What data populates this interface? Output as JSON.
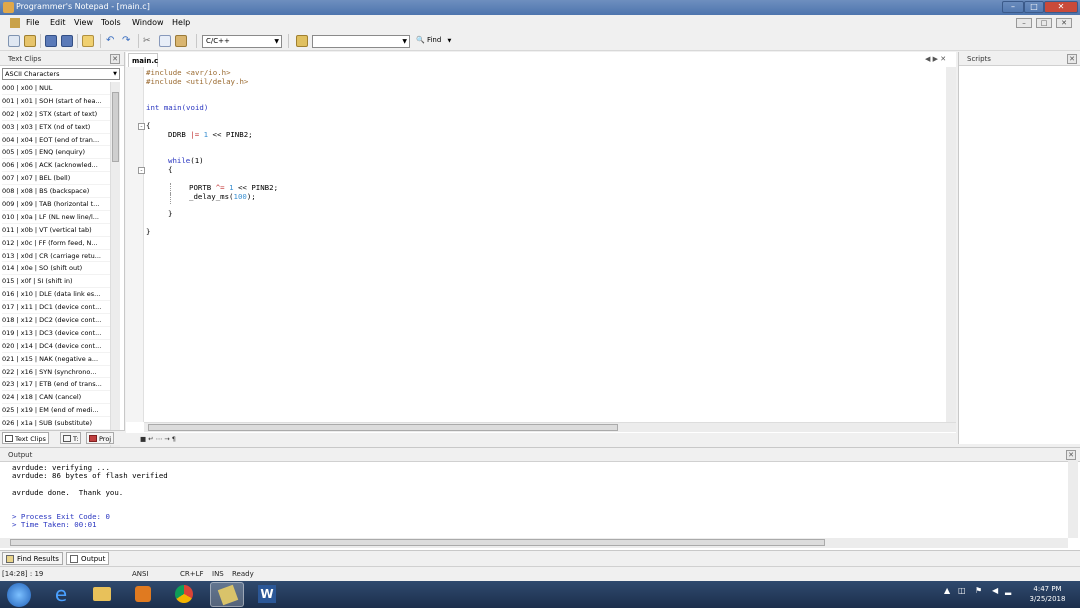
{
  "window": {
    "title": "Programmer's Notepad - [main.c]"
  },
  "menu": [
    "File",
    "Edit",
    "View",
    "Tools",
    "Window",
    "Help"
  ],
  "toolbar": {
    "scheme_value": "C/C++",
    "search_value": "",
    "find_label": "Find"
  },
  "left_panel": {
    "title": "Text Clips",
    "category": "ASCII Characters",
    "items": [
      "000 | x00 | NUL",
      "001 | x01 | SOH (start of hea...",
      "002 | x02 | STX (start of text)",
      "003 | x03 | ETX (nd of text)",
      "004 | x04 | EOT (end of tran...",
      "005 | x05 | ENQ (enquiry)",
      "006 | x06 | ACK (acknowled...",
      "007 | x07 | BEL (bell)",
      "008 | x08 | BS (backspace)",
      "009 | x09 | TAB (horizontal t...",
      "010 | x0a | LF (NL new line/l...",
      "011 | x0b | VT (vertical tab)",
      "012 | x0c | FF (form feed, N...",
      "013 | x0d | CR (carriage retu...",
      "014 | x0e | SO (shift out)",
      "015 | x0f | SI (shift in)",
      "016 | x10 | DLE (data link es...",
      "017 | x11 | DC1 (device cont...",
      "018 | x12 | DC2 (device cont...",
      "019 | x13 | DC3 (device cont...",
      "020 | x14 | DC4 (device cont...",
      "021 | x15 | NAK (negative a...",
      "022 | x16 | SYN (synchrono...",
      "023 | x17 | ETB (end of trans...",
      "024 | x18 | CAN (cancel)",
      "025 | x19 | EM (end of medi...",
      "026 | x1a | SUB (substitute)"
    ],
    "tabs": [
      "Text Clips",
      "T:",
      "Proj"
    ]
  },
  "editor": {
    "tab": "main.c",
    "code": {
      "inc1": "#include <avr/io.h>",
      "inc2": "#include <util/delay.h>",
      "main_kw": "int",
      "main_rest": "main(void)",
      "brace_open": "{",
      "ddrb": "DDRB",
      "ddrb_op": "|=",
      "ddrb_val": "1",
      "ddrb_shift": "<<",
      "ddrb_pin": "PINB2;",
      "while_kw": "while",
      "while_arg": "(1)",
      "while_brace": "{",
      "portb": "PORTB",
      "portb_op": "^=",
      "portb_val": "1",
      "portb_shift": "<<",
      "portb_pin": "PINB2;",
      "delay_fn": "_delay_ms(",
      "delay_val": "100",
      "delay_end": ");",
      "while_close": "}",
      "brace_close": "}"
    }
  },
  "right_panel": {
    "title": "Scripts"
  },
  "output": {
    "title": "Output",
    "lines": [
      "avrdude: verifying ...",
      "avrdude: 86 bytes of flash verified",
      "avrdude done.  Thank you.",
      "> Process Exit Code: 0",
      "> Time Taken: 00:01"
    ]
  },
  "bottom_tabs": [
    "Find Results",
    "Output"
  ],
  "status": {
    "position": "[14:28] : 19",
    "encoding": "ANSI",
    "line_ending": "CR+LF",
    "insert_mode": "INS",
    "state": "Ready"
  },
  "taskbar": {
    "time": "4:47 PM",
    "date": "3/25/2018"
  },
  "colors": {
    "keyword": "#2a36c0",
    "preprocessor": "#9a6a30",
    "number": "#3a8fd0",
    "taskbar": "#1c2f4c"
  }
}
